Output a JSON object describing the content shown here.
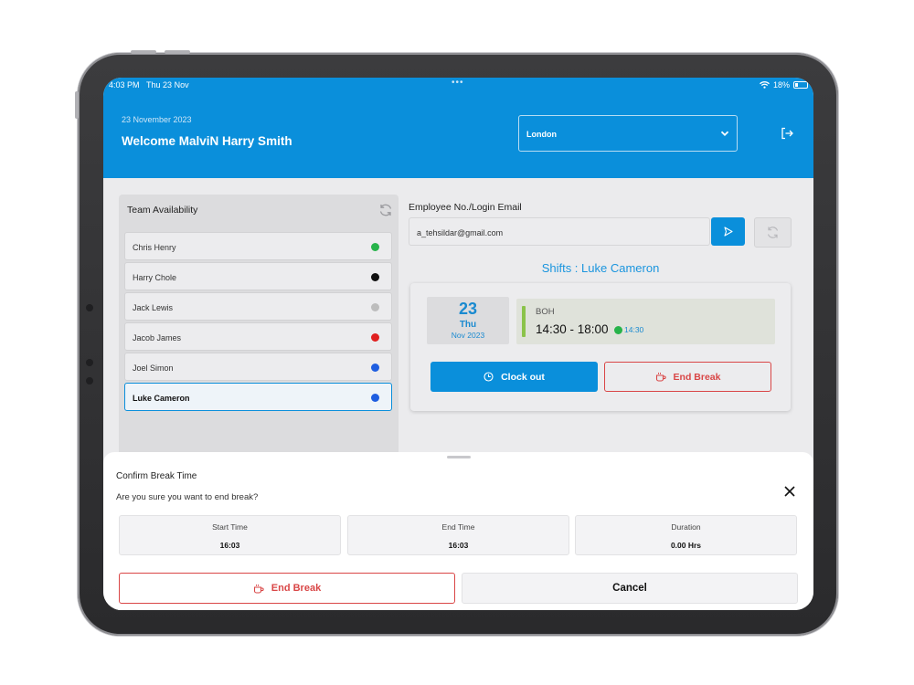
{
  "status_bar": {
    "time": "4:03 PM",
    "date": "Thu 23 Nov",
    "battery": "18%",
    "dots": "•••"
  },
  "header": {
    "date": "23 November 2023",
    "welcome": "Welcome MalviN Harry Smith",
    "location": "London",
    "accent_color": "#0a8fdb"
  },
  "team": {
    "title": "Team Availability",
    "members": [
      {
        "name": "Chris Henry",
        "status_color": "#27b34a"
      },
      {
        "name": "Harry Chole",
        "status_color": "#111111"
      },
      {
        "name": "Jack Lewis",
        "status_color": "#bdbdbd"
      },
      {
        "name": "Jacob James",
        "status_color": "#e02020"
      },
      {
        "name": "Joel Simon",
        "status_color": "#1f5ee0"
      },
      {
        "name": "Luke Cameron",
        "status_color": "#1f5ee0"
      }
    ]
  },
  "employee": {
    "label": "Employee No./Login Email",
    "value": "a_tehsildar@gmail.com"
  },
  "shifts": {
    "title": "Shifts : Luke Cameron",
    "day": "23",
    "weekday": "Thu",
    "month_year": "Nov 2023",
    "role": "BOH",
    "time_range": "14:30 - 18:00",
    "clock_in": "14:30",
    "clock_out_label": "Clock out",
    "end_break_label": "End Break"
  },
  "sheet": {
    "title": "Confirm Break Time",
    "message": "Are you sure you want to end break?",
    "start_label": "Start Time",
    "start_value": "16:03",
    "end_label": "End Time",
    "end_value": "16:03",
    "duration_label": "Duration",
    "duration_value": "0.00 Hrs",
    "end_break_label": "End Break",
    "cancel_label": "Cancel"
  }
}
